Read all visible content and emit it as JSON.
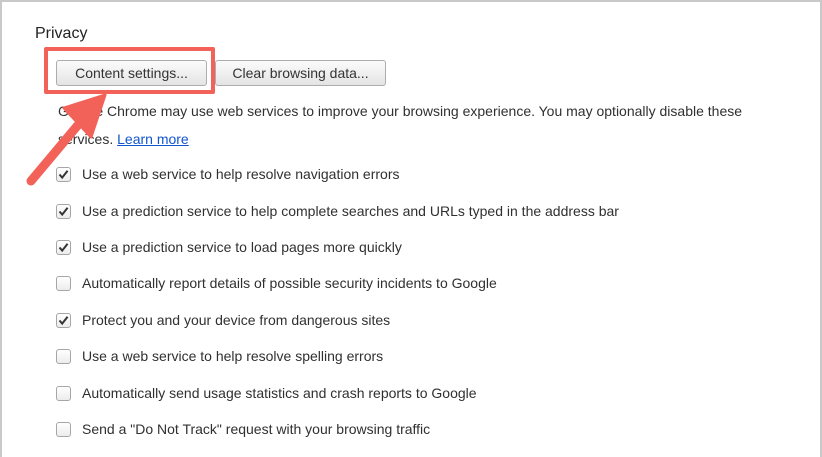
{
  "privacy": {
    "title": "Privacy",
    "content_settings_label": "Content settings...",
    "clear_browsing_label": "Clear browsing data...",
    "description": "Google Chrome may use web services to improve your browsing experience. You may optionally disable these services.",
    "learn_more": "Learn more",
    "options": [
      {
        "label": "Use a web service to help resolve navigation errors",
        "checked": true
      },
      {
        "label": "Use a prediction service to help complete searches and URLs typed in the address bar",
        "checked": true
      },
      {
        "label": "Use a prediction service to load pages more quickly",
        "checked": true
      },
      {
        "label": "Automatically report details of possible security incidents to Google",
        "checked": false
      },
      {
        "label": "Protect you and your device from dangerous sites",
        "checked": true
      },
      {
        "label": "Use a web service to help resolve spelling errors",
        "checked": false
      },
      {
        "label": "Automatically send usage statistics and crash reports to Google",
        "checked": false
      },
      {
        "label": "Send a \"Do Not Track\" request with your browsing traffic",
        "checked": false
      }
    ]
  },
  "colors": {
    "annotation": "#f26258",
    "link": "#1155cc"
  }
}
